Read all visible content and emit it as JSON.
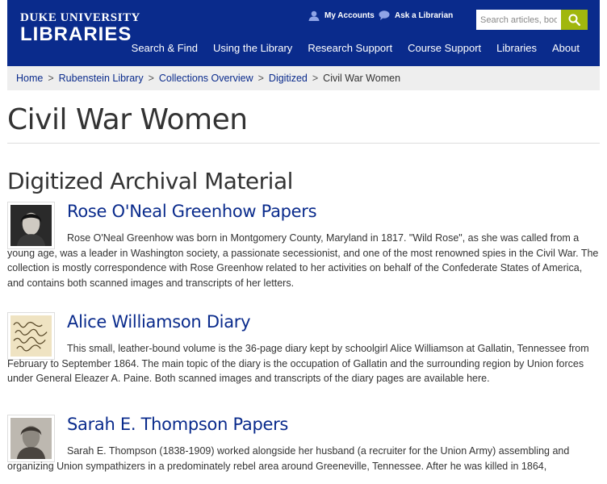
{
  "header": {
    "logo_line1": "DUKE UNIVERSITY",
    "logo_line2": "LIBRARIES",
    "utility": {
      "my_accounts": "My Accounts",
      "ask_librarian": "Ask a Librarian"
    },
    "search": {
      "placeholder": "Search articles, books",
      "button_icon": "search-icon"
    },
    "nav": [
      "Search & Find",
      "Using the Library",
      "Research Support",
      "Course Support",
      "Libraries",
      "About"
    ]
  },
  "breadcrumb": {
    "items": [
      "Home",
      "Rubenstein Library",
      "Collections Overview",
      "Digitized"
    ],
    "current": "Civil War Women",
    "separator": ">"
  },
  "page_title": "Civil War Women",
  "section_heading": "Digitized Archival Material",
  "items": [
    {
      "title": "Rose O'Neal Greenhow Papers",
      "description": "Rose O'Neal Greenhow was born in Montgomery County, Maryland in 1817. \"Wild Rose\", as she was called from a young age, was a leader in Washington society, a passionate secessionist, and one of the most renowned spies in the Civil War. The collection is mostly correspondence with Rose Greenhow related to her activities on behalf of the Confederate States of America, and contains both scanned images and transcripts of her letters.",
      "thumb": "portrait-photo"
    },
    {
      "title": "Alice Williamson Diary",
      "description": "This small, leather-bound volume is the 36-page diary kept by schoolgirl Alice Williamson at Gallatin, Tennessee from February to September 1864. The main topic of the diary is the occupation of Gallatin and the surrounding region by Union forces under General Eleazer A. Paine. Both scanned images and transcripts of the diary pages are available here.",
      "thumb": "handwriting-image"
    },
    {
      "title": "Sarah E. Thompson Papers",
      "description": "Sarah E. Thompson (1838-1909) worked alongside her husband (a recruiter for the Union Army) assembling and organizing Union sympathizers in a predominately rebel area around Greeneville, Tennessee. After he was killed in 1864,",
      "thumb": "portrait-photo"
    }
  ],
  "colors": {
    "brand_blue": "#0a2b8c",
    "search_green": "#a1b70d",
    "breadcrumb_bg": "#eeeeee"
  }
}
